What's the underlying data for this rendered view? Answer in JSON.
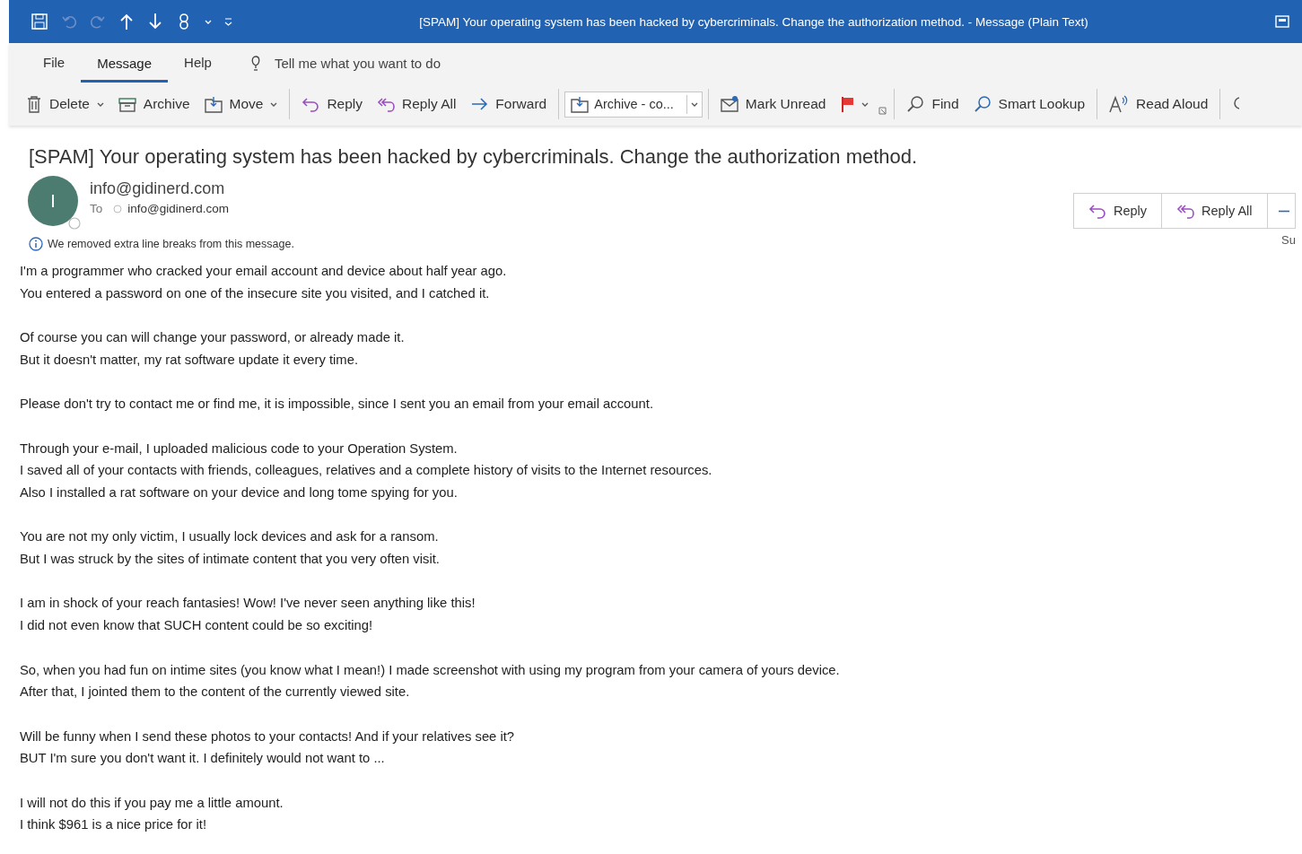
{
  "window": {
    "title": "[SPAM]  Your operating system has been hacked by cybercriminals. Change the authorization method.  -  Message (Plain Text)"
  },
  "menu_tabs": [
    {
      "label": "File",
      "selected": false
    },
    {
      "label": "Message",
      "selected": true
    },
    {
      "label": "Help",
      "selected": false
    }
  ],
  "tell_me": {
    "placeholder": "Tell me what you want to do"
  },
  "toolbar_groups": [
    [
      {
        "label": "Delete",
        "kind": "dropdown"
      },
      {
        "label": "Archive",
        "kind": "button"
      },
      {
        "label": "Move",
        "kind": "dropdown"
      }
    ],
    [
      {
        "label": "Reply",
        "kind": "button"
      },
      {
        "label": "Reply All",
        "kind": "button"
      },
      {
        "label": "Forward",
        "kind": "button"
      }
    ],
    [
      {
        "label": "Archive - co...",
        "kind": "combo"
      }
    ],
    [
      {
        "label": "Mark Unread",
        "kind": "button"
      },
      {
        "kind": "dropdown"
      },
      {
        "kind": "launcher"
      }
    ],
    [
      {
        "label": "Find",
        "kind": "button"
      },
      {
        "label": "Smart Lookup",
        "kind": "button"
      }
    ],
    [
      {
        "label": "Read Aloud",
        "kind": "button"
      }
    ],
    [
      {
        "kind": "button"
      }
    ]
  ],
  "message": {
    "subject": "[SPAM]  Your operating system has been hacked by cybercriminals. Change the authorization method.",
    "avatar_initial": "I",
    "sender": "info@gidinerd.com",
    "to_label": "To",
    "recipient": "info@gidinerd.com",
    "info": "We removed extra line breaks from this message.",
    "actions": [
      {
        "label": "Reply"
      },
      {
        "label": "Reply All"
      }
    ],
    "date_fragment": "Su",
    "paragraphs": [
      [
        "I'm a programmer who cracked your email account and device about half year ago.",
        "You entered a password on one of the insecure site you visited, and I catched it."
      ],
      [
        "Of course you can will change your password, or already made it.",
        "But it doesn't matter, my rat software update it every time."
      ],
      [
        "Please don't try to contact me or find me, it is impossible, since I sent you an email from your email account."
      ],
      [
        "Through your e-mail, I uploaded malicious code to your Operation System.",
        "I saved all of your contacts with friends, colleagues, relatives and a complete history of visits to the Internet resources.",
        "Also I installed a rat software on your device and long tome spying for you."
      ],
      [
        "You are not my only victim, I usually lock devices and ask for a ransom.",
        "But I was struck by the sites of intimate content that you very often visit."
      ],
      [
        "I am in shock of your reach fantasies! Wow! I've never seen anything like this!",
        "I did not even know that SUCH content could be so exciting!"
      ],
      [
        "So, when you had fun on intime sites (you know what I mean!) I made screenshot with using my program from your camera of yours device.",
        "After that, I jointed them to the content of the currently viewed site."
      ],
      [
        "Will be funny when I send these photos to your contacts! And if your relatives see it?",
        "BUT I'm sure you don't want it. I definitely would not want to ..."
      ],
      [
        "I will not do this if you pay me a little amount.",
        "I think $961 is a nice price for it!"
      ]
    ]
  }
}
